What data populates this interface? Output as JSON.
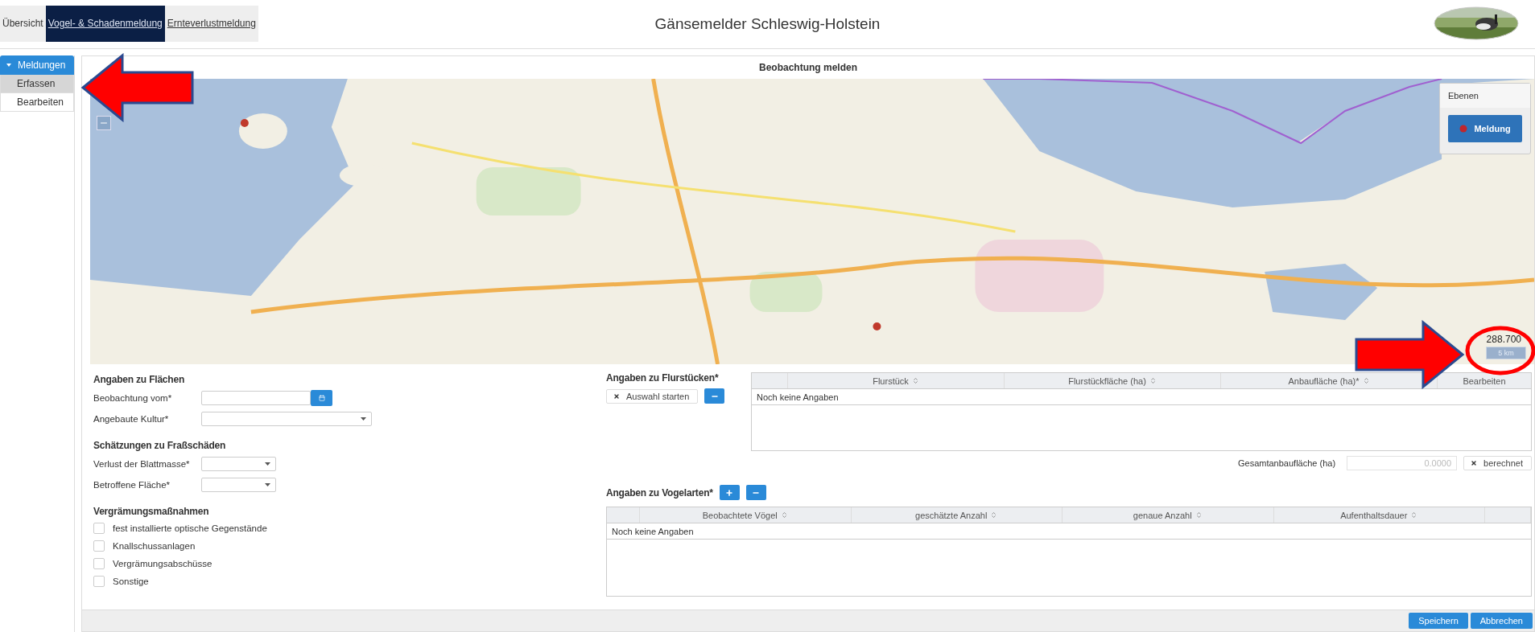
{
  "nav_tabs": [
    {
      "label": "Übersicht",
      "selected": false,
      "link": false
    },
    {
      "label": "Vogel- & Schadenmeldung",
      "selected": true,
      "link": true
    },
    {
      "label": "Ernteverlustmeldung",
      "selected": false,
      "link": true
    }
  ],
  "app_title": "Gänsemelder Schleswig-Holstein",
  "logo": {
    "kind": "picture"
  },
  "sidebar": {
    "group": {
      "label": "Meldungen",
      "expanded": true
    },
    "items": [
      {
        "label": "Erfassen",
        "selected": true
      },
      {
        "label": "Bearbeiten",
        "selected": false
      }
    ]
  },
  "panel_title": "Beobachtung melden",
  "map": {
    "kind": "picture",
    "layers": {
      "title": "Ebenen",
      "items": [
        {
          "label": "Meldung"
        }
      ]
    },
    "scale": {
      "ratio": "288.700",
      "bar": "5 km"
    }
  },
  "annotations": [
    {
      "kind": "arrow_left"
    },
    {
      "kind": "arrow_right"
    },
    {
      "kind": "ellipse"
    }
  ],
  "form_sections": [
    {
      "title": "Angaben zu Flächen",
      "fields": [
        {
          "label": "Beobachtung vom*",
          "kind": "date"
        },
        {
          "label": "Angebaute Kultur*",
          "kind": "select_wide"
        }
      ]
    },
    {
      "title": "Schätzungen zu Fraßschäden",
      "fields": [
        {
          "label": "Verlust der Blattmasse*",
          "kind": "select"
        },
        {
          "label": "Betroffene Fläche*",
          "kind": "select"
        }
      ]
    },
    {
      "title": "Vergrämungsmaßnahmen",
      "checkboxes": [
        {
          "label": "fest installierte optische Gegenstände",
          "checked": false
        },
        {
          "label": "Knallschussanlagen",
          "checked": false
        },
        {
          "label": "Vergrämungsabschüsse",
          "checked": false
        },
        {
          "label": "Sonstige",
          "checked": false
        }
      ]
    }
  ],
  "parcels": {
    "title": "Angaben zu Flurstücken*",
    "select_button": "Auswahl starten",
    "columns": [
      {
        "label": "Flurstück",
        "sortable": true
      },
      {
        "label": "Flurstückfläche (ha)",
        "sortable": true
      },
      {
        "label": "Anbaufläche (ha)*",
        "sortable": true
      },
      {
        "label": "Bearbeiten",
        "sortable": false
      }
    ],
    "empty": "Noch keine Angaben",
    "total": {
      "label": "Gesamtanbaufläche (ha)",
      "value": "0.0000",
      "button": "berechnet"
    }
  },
  "birds": {
    "title": "Angaben zu Vogelarten*",
    "columns": [
      {
        "label": "Beobachtete Vögel",
        "sortable": true
      },
      {
        "label": "geschätzte Anzahl",
        "sortable": true
      },
      {
        "label": "genaue Anzahl",
        "sortable": true
      },
      {
        "label": "Aufenthaltsdauer",
        "sortable": true
      }
    ],
    "empty": "Noch keine Angaben"
  },
  "footer_buttons": [
    "Speichern",
    "Abbrechen"
  ]
}
